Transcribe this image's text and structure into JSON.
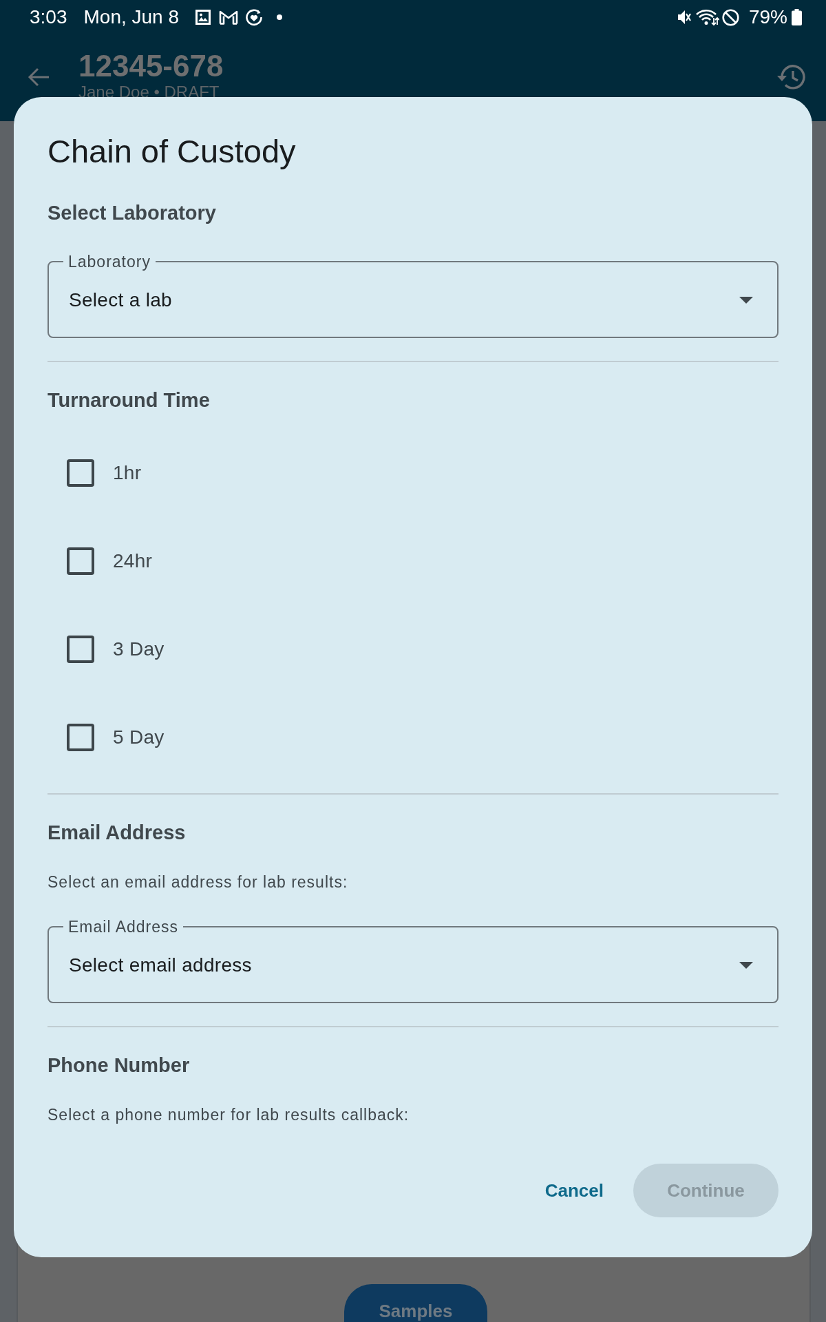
{
  "status_bar": {
    "time": "3:03",
    "date": "Mon, Jun 8",
    "battery": "79%"
  },
  "header": {
    "title": "12345-678",
    "subtitle": "Jane Doe • DRAFT"
  },
  "background_page": {
    "button": "Samples"
  },
  "dialog": {
    "title": "Chain of Custody",
    "sections": [
      {
        "kind": "select",
        "heading": "Select Laboratory",
        "field": {
          "label": "Laboratory",
          "placeholder": "Select a lab"
        }
      },
      {
        "kind": "checkboxes",
        "heading": "Turnaround Time",
        "options": [
          {
            "label": "1hr",
            "checked": false
          },
          {
            "label": "24hr",
            "checked": false
          },
          {
            "label": "3 Day",
            "checked": false
          },
          {
            "label": "5 Day",
            "checked": false
          }
        ]
      },
      {
        "kind": "select",
        "heading": "Email Address",
        "description": "Select an email address for lab results:",
        "field": {
          "label": "Email Address",
          "placeholder": "Select email address"
        }
      },
      {
        "kind": "text",
        "heading": "Phone Number",
        "description": "Select a phone number for lab results callback:"
      }
    ],
    "actions": [
      {
        "label": "Cancel",
        "kind": "text",
        "disabled": false
      },
      {
        "label": "Continue",
        "kind": "filled",
        "disabled": true
      }
    ]
  }
}
